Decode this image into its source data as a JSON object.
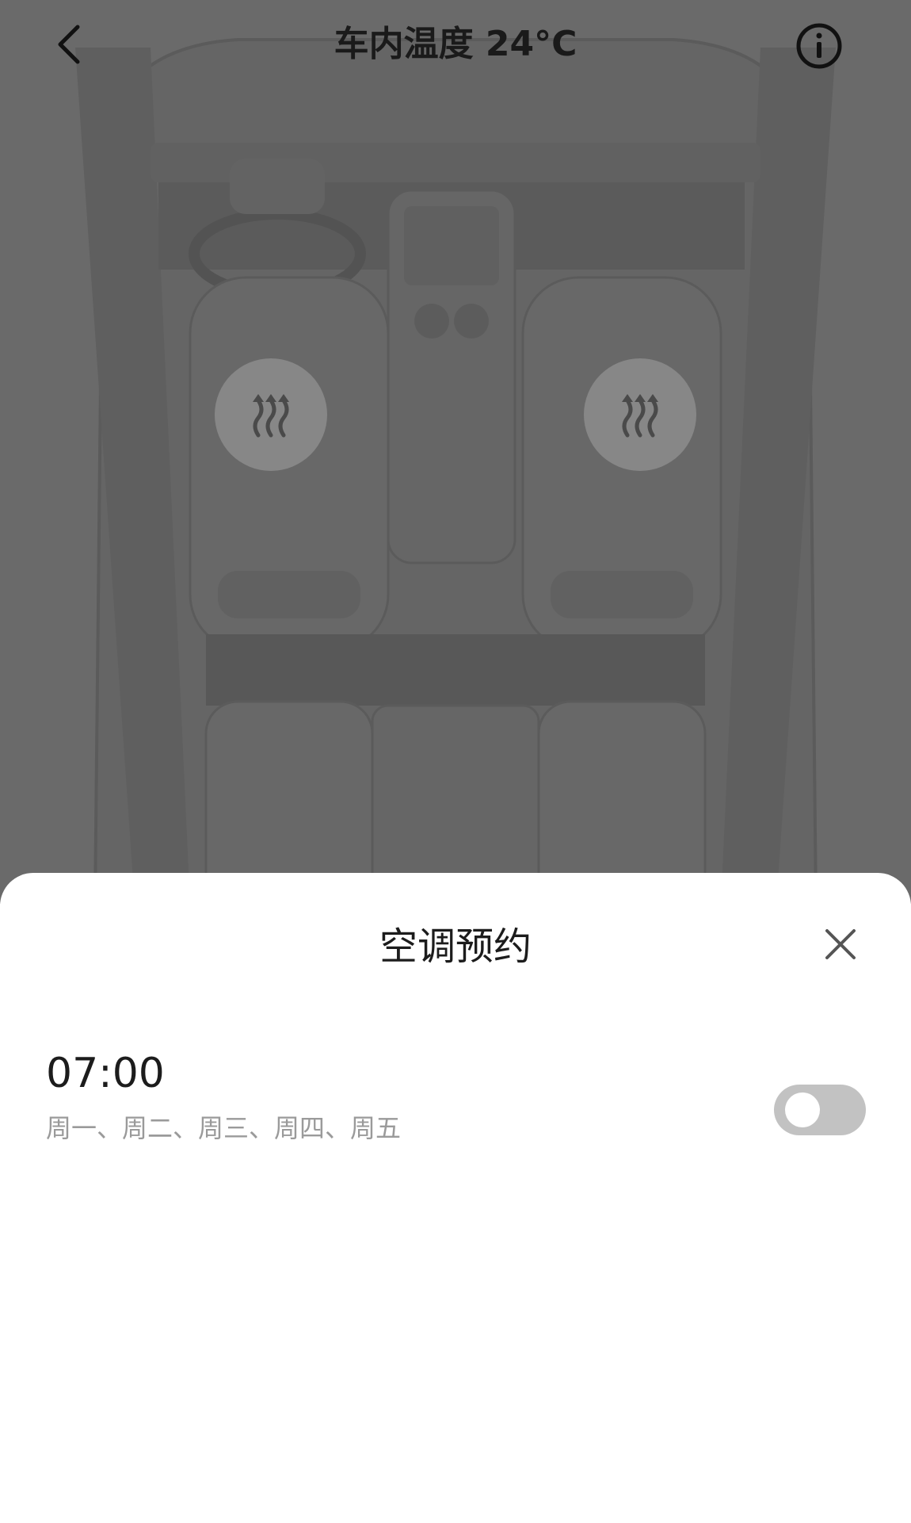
{
  "header": {
    "title": "车内温度 24°C",
    "back_icon": "chevron-left-icon",
    "info_icon": "info-icon"
  },
  "seat_heating": {
    "icon": "heat-waves-icon",
    "seats": [
      "driver",
      "passenger"
    ]
  },
  "sheet": {
    "title": "空调预约",
    "close_icon": "close-icon",
    "schedules": [
      {
        "time": "07:00",
        "days": "周一、周二、周三、周四、周五",
        "enabled": false
      }
    ]
  },
  "colors": {
    "overlay": "#000000",
    "toggle_off": "#c2c2c2",
    "subtitle_text": "#9a9a9a"
  }
}
